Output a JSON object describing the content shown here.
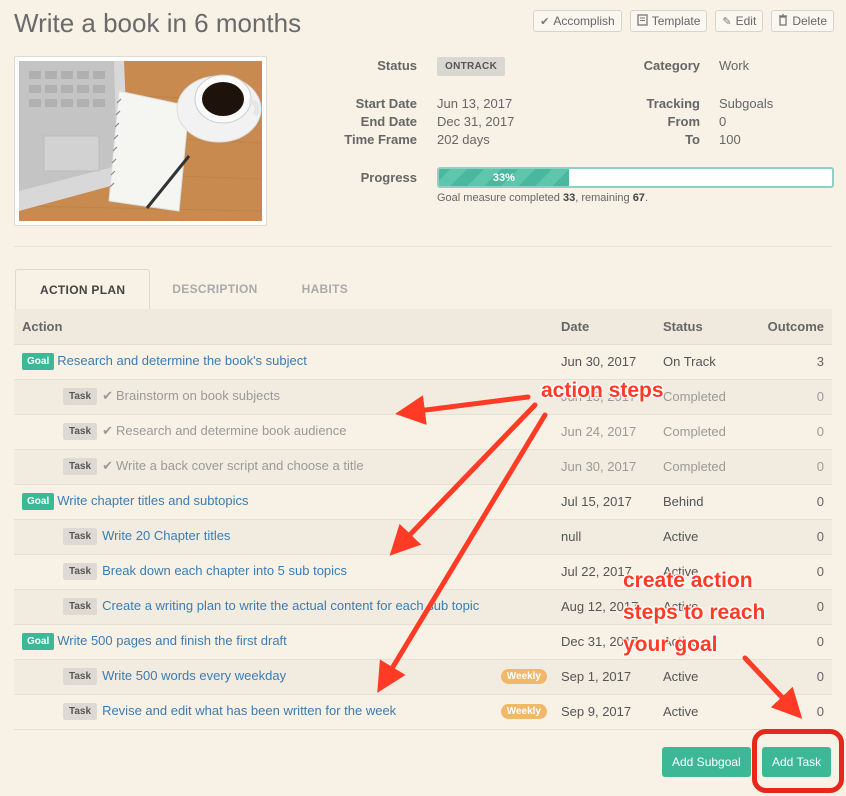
{
  "page": {
    "title": "Write a book in 6 months"
  },
  "toolbar": {
    "accomplish": "Accomplish",
    "template": "Template",
    "edit": "Edit",
    "delete": "Delete"
  },
  "info": {
    "status_label": "Status",
    "status_value": "ONTRACK",
    "start_label": "Start Date",
    "start_value": "Jun 13, 2017",
    "end_label": "End Date",
    "end_value": "Dec 31, 2017",
    "timeframe_label": "Time Frame",
    "timeframe_value": "202 days",
    "category_label": "Category",
    "category_value": "Work",
    "tracking_label": "Tracking",
    "tracking_value": "Subgoals",
    "from_label": "From",
    "from_value": "0",
    "to_label": "To",
    "to_value": "100",
    "progress_label": "Progress",
    "progress_text": "33%",
    "progress_percent": 33,
    "progress_note_prefix": "Goal measure completed ",
    "progress_completed": "33",
    "progress_note_mid": ", remaining ",
    "progress_remaining": "67",
    "progress_note_suffix": "."
  },
  "tabs": [
    "ACTION PLAN",
    "DESCRIPTION",
    "HABITS"
  ],
  "table": {
    "headers": {
      "action": "Action",
      "date": "Date",
      "status": "Status",
      "outcome": "Outcome"
    },
    "rows": [
      {
        "kind": "Goal",
        "title": "Research and determine the book's subject",
        "date": "Jun 30, 2017",
        "status": "On Track",
        "outcome": "3",
        "done": false,
        "weekly": ""
      },
      {
        "kind": "Task",
        "title": "Brainstorm on book subjects",
        "date": "Jun 13, 2017",
        "status": "Completed",
        "outcome": "0",
        "done": true,
        "weekly": ""
      },
      {
        "kind": "Task",
        "title": "Research and determine book audience",
        "date": "Jun 24, 2017",
        "status": "Completed",
        "outcome": "0",
        "done": true,
        "weekly": ""
      },
      {
        "kind": "Task",
        "title": "Write a back cover script and choose a title",
        "date": "Jun 30, 2017",
        "status": "Completed",
        "outcome": "0",
        "done": true,
        "weekly": ""
      },
      {
        "kind": "Goal",
        "title": "Write chapter titles and subtopics",
        "date": "Jul 15, 2017",
        "status": "Behind",
        "outcome": "0",
        "done": false,
        "weekly": ""
      },
      {
        "kind": "Task",
        "title": "Write 20 Chapter titles",
        "date": "null",
        "status": "Active",
        "outcome": "0",
        "done": false,
        "weekly": ""
      },
      {
        "kind": "Task",
        "title": "Break down each chapter into 5 sub topics",
        "date": "Jul 22, 2017",
        "status": "Active",
        "outcome": "0",
        "done": false,
        "weekly": ""
      },
      {
        "kind": "Task",
        "title": "Create a writing plan to write the actual content for each sub topic",
        "date": "Aug 12, 2017",
        "status": "Active",
        "outcome": "0",
        "done": false,
        "weekly": ""
      },
      {
        "kind": "Goal",
        "title": "Write 500 pages and finish the first draft",
        "date": "Dec 31, 2017",
        "status": "Active",
        "outcome": "0",
        "done": false,
        "weekly": ""
      },
      {
        "kind": "Task",
        "title": "Write 500 words every weekday",
        "date": "Sep 1, 2017",
        "status": "Active",
        "outcome": "0",
        "done": false,
        "weekly": "Weekly"
      },
      {
        "kind": "Task",
        "title": "Revise and edit what has been written for the week",
        "date": "Sep 9, 2017",
        "status": "Active",
        "outcome": "0",
        "done": false,
        "weekly": "Weekly"
      }
    ]
  },
  "buttons": {
    "add_subgoal": "Add Subgoal",
    "add_task": "Add Task"
  },
  "annotations": {
    "action_steps": "action steps",
    "create_line1": "create action",
    "create_line2": "steps to reach",
    "create_line3": "your goal"
  },
  "colors": {
    "accent": "#3cb897",
    "callout": "#ff3b25",
    "link": "#3b7db4",
    "weekly": "#f1b86a"
  }
}
